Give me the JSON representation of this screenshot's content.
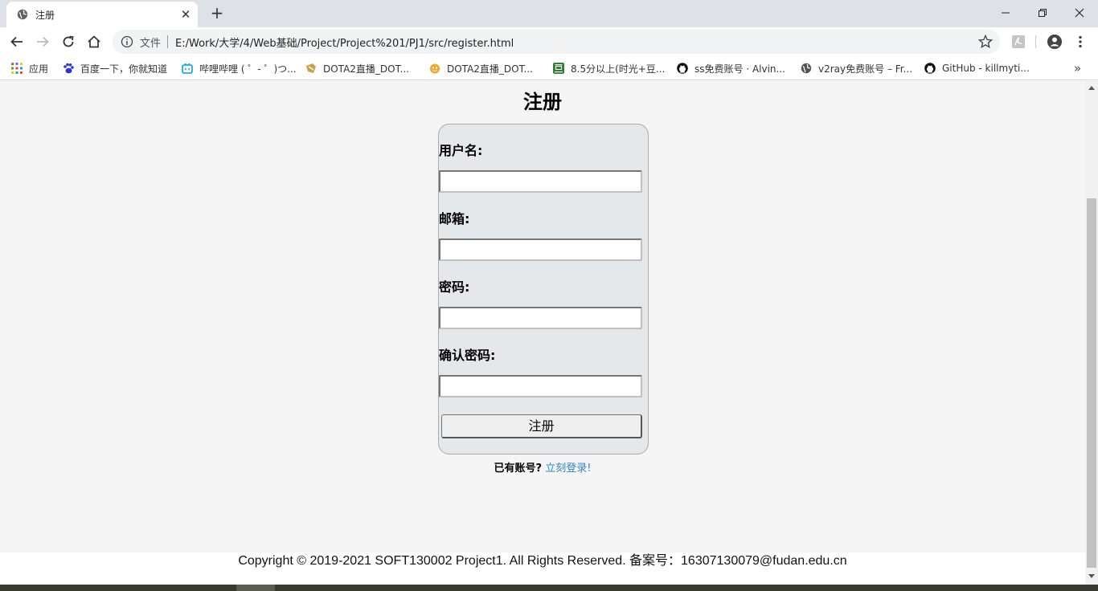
{
  "browser": {
    "tab": {
      "title": "注册",
      "favicon": "globe-icon"
    },
    "window_controls": [
      "minimize-icon",
      "restore-icon",
      "close-icon"
    ],
    "toolbar": {
      "file_label": "文件",
      "url": "E:/Work/大学/4/Web基础/Project/Project%201/PJ1/src/register.html"
    },
    "bookmarks": [
      {
        "label": "应用",
        "icon": "apps-grid-icon",
        "color": "#1a73e8"
      },
      {
        "label": "百度一下，你就知道",
        "icon": "baidu-paw-icon",
        "color": "#2932e1"
      },
      {
        "label": "哔哩哔哩 ( ゜- ゜)つ...",
        "icon": "bilibili-icon",
        "color": "#00a1d6"
      },
      {
        "label": "DOTA2直播_DOT...",
        "icon": "dota-icon",
        "color": "#c9a04a"
      },
      {
        "label": "DOTA2直播_DOT...",
        "icon": "douyu-icon",
        "color": "#f5a623"
      },
      {
        "label": "8.5分以上(时光+豆...",
        "icon": "douban-icon",
        "color": "#2e7d32"
      },
      {
        "label": "ss免费账号 · Alvin...",
        "icon": "github-icon",
        "color": "#111111"
      },
      {
        "label": "v2ray免费账号 – Fr...",
        "icon": "globe-icon",
        "color": "#555555"
      },
      {
        "label": "GitHub - killmyti...",
        "icon": "github-icon",
        "color": "#111111"
      }
    ],
    "more_bookmarks": "»"
  },
  "page": {
    "title": "注册",
    "form": {
      "username_label": "用户名:",
      "username_value": "",
      "email_label": "邮箱:",
      "email_value": "",
      "password_label": "密码:",
      "password_value": "",
      "confirm_label": "确认密码:",
      "confirm_value": "",
      "submit_label": "注册"
    },
    "login_prompt": "已有账号?",
    "login_link": "立刻登录!",
    "footer": "Copyright © 2019-2021 SOFT130002 Project1. All Rights Reserved. 备案号：16307130079@fudan.edu.cn"
  },
  "colors": {
    "card_bg": "#e5e8eb",
    "link": "#2f86c8",
    "page_bg": "#f5f5f5"
  }
}
